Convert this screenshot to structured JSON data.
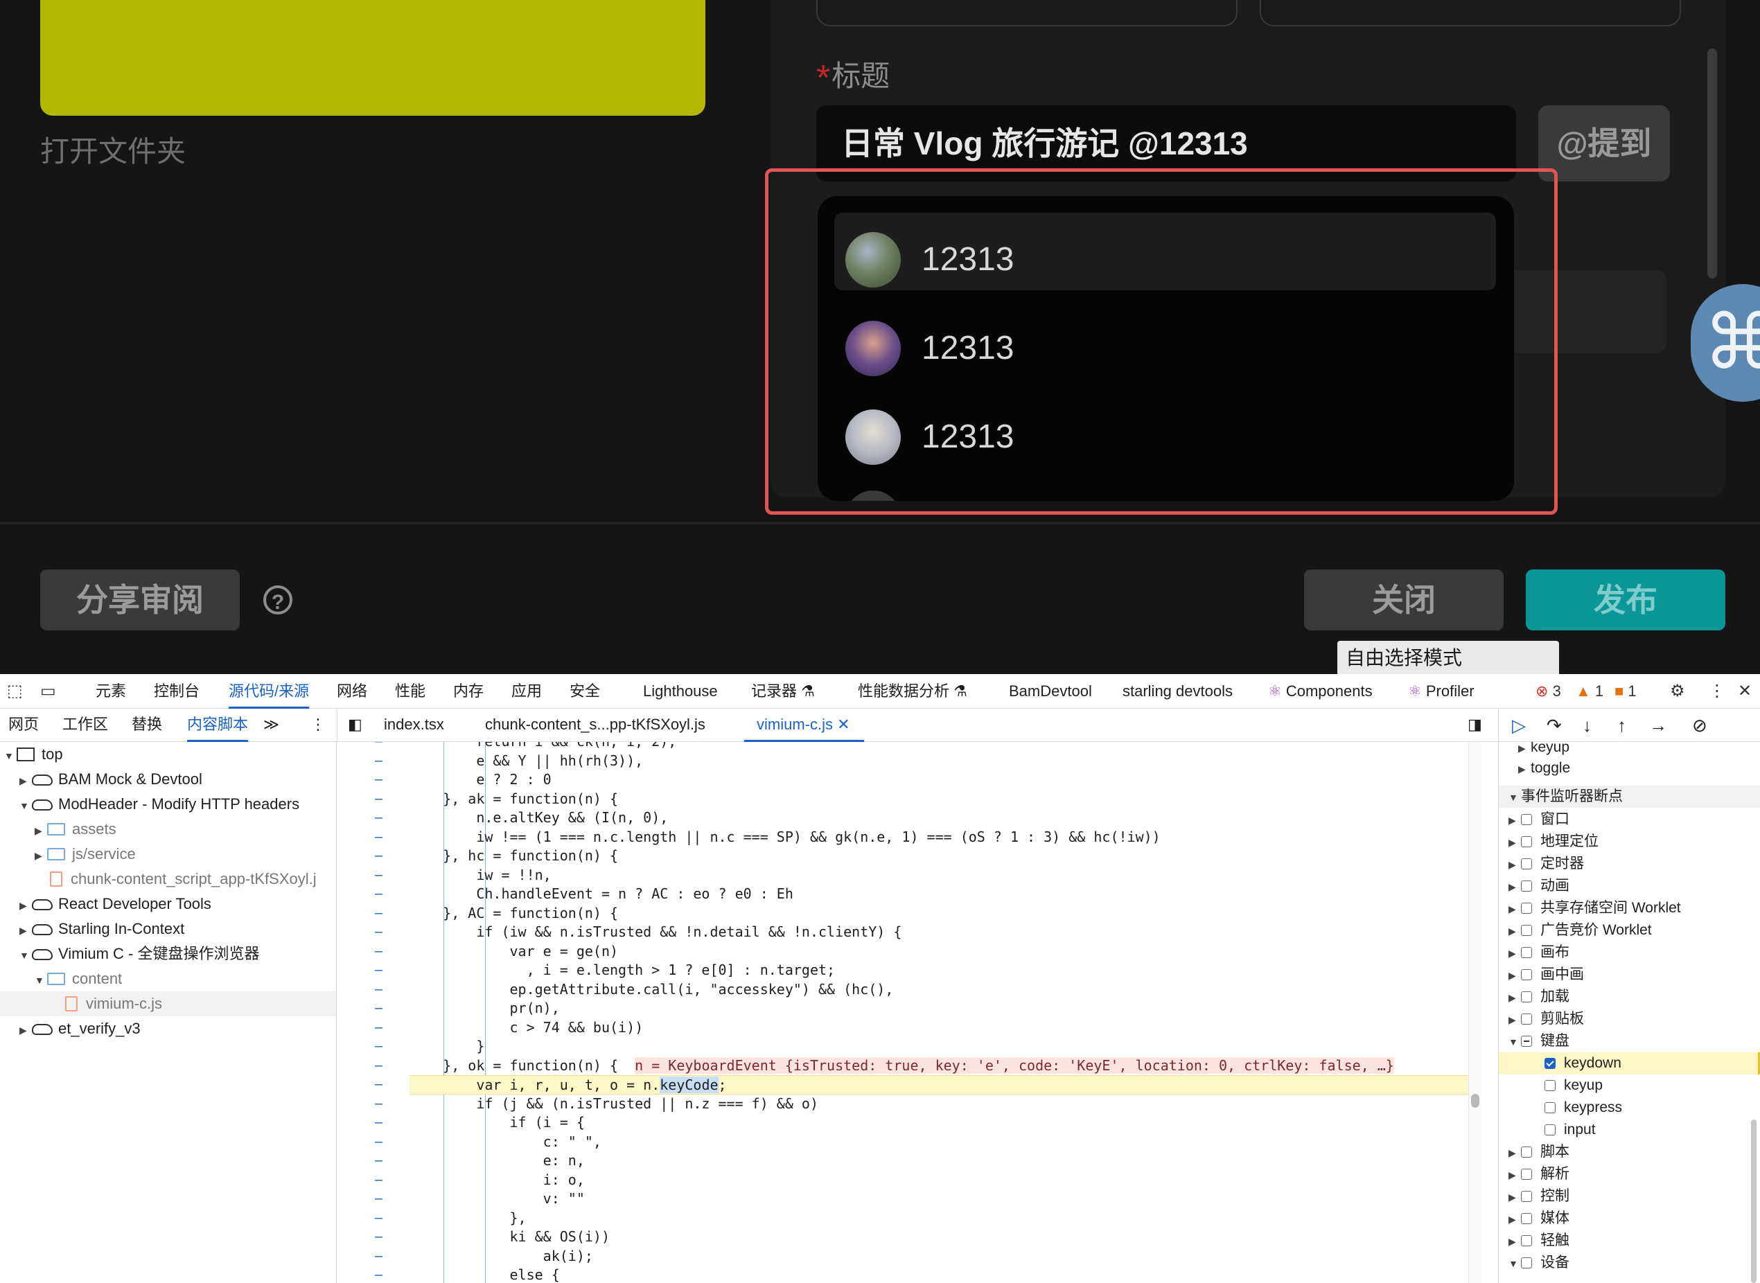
{
  "app": {
    "open_folder": "打开文件夹",
    "title_label": "标题",
    "required_mark": "*",
    "title_value": "日常 Vlog 旅行游记 @12313",
    "mention_button": "@提到",
    "mention_list": [
      {
        "name": "12313",
        "avatar_color": "#7a8a6f"
      },
      {
        "name": "12313",
        "avatar_color": "#5a4a80"
      },
      {
        "name": "12313",
        "avatar_color": "#b9bcc4"
      }
    ],
    "share_review_button": "分享审阅",
    "help_icon": "?",
    "close_button": "关闭",
    "publish_button": "发布",
    "tooltip": "自由选择模式",
    "float_icon": "⌘",
    "colors": {
      "accent": "#0b9698",
      "highlight": "#e35454",
      "yellow_block": "#b5b800"
    }
  },
  "devtools": {
    "main_tabs": [
      "元素",
      "控制台",
      "源代码/来源",
      "网络",
      "性能",
      "内存",
      "应用",
      "安全",
      "Lighthouse",
      "记录器 ⚗",
      "性能数据分析 ⚗",
      "BamDevtool",
      "starling devtools",
      "Components",
      "Profiler"
    ],
    "active_main_tab": "源代码/来源",
    "status": {
      "errors": "3",
      "warnings": "1",
      "issues": "1"
    },
    "sub_tabs": [
      "网页",
      "工作区",
      "替换",
      "内容脚本"
    ],
    "active_sub_tab": "内容脚本",
    "file_tabs": [
      "index.tsx",
      "chunk-content_s...pp-tKfSXoyl.js",
      "vimium-c.js"
    ],
    "active_file_tab": "vimium-c.js",
    "tree": [
      {
        "label": "top",
        "level": 0,
        "icon": "frame",
        "open": true
      },
      {
        "label": "BAM Mock & Devtool",
        "level": 1,
        "icon": "cloud",
        "open": false
      },
      {
        "label": "ModHeader - Modify HTTP headers",
        "level": 1,
        "icon": "cloud",
        "open": true
      },
      {
        "label": "assets",
        "level": 2,
        "icon": "folder",
        "open": false
      },
      {
        "label": "js/service",
        "level": 2,
        "icon": "folder",
        "open": false
      },
      {
        "label": "chunk-content_script_app-tKfSXoyl.j",
        "level": 3,
        "icon": "file"
      },
      {
        "label": "React Developer Tools",
        "level": 1,
        "icon": "cloud",
        "open": false
      },
      {
        "label": "Starling In-Context",
        "level": 1,
        "icon": "cloud",
        "open": false
      },
      {
        "label": "Vimium C - 全键盘操作浏览器",
        "level": 1,
        "icon": "cloud",
        "open": true
      },
      {
        "label": "content",
        "level": 2,
        "icon": "folder",
        "open": true
      },
      {
        "label": "vimium-c.js",
        "level": 3,
        "icon": "file",
        "selected": true
      },
      {
        "label": "et_verify_v3",
        "level": 1,
        "icon": "cloud",
        "open": false
      }
    ],
    "code": {
      "line_01": "        return i && ck(n, i, 2),",
      "line_02": "        e && Y || hh(rh(3)),",
      "line_03": "        e ? 2 : 0",
      "line_04": "    }, ak = function(n) {",
      "line_05": "        n.e.altKey && (I(n, 0),",
      "line_06": "        iw !== (1 === n.c.length || n.c === SP) && gk(n.e, 1) === (oS ? 1 : 3) && hc(!iw))",
      "line_07": "    }, hc = function(n) {",
      "line_08": "        iw = !!n,",
      "line_09": "        Ch.handleEvent = n ? AC : eo ? e0 : Eh",
      "line_10": "    }, AC = function(n) {",
      "line_11": "        if (iw && n.isTrusted && !n.detail && !n.clientY) {",
      "line_12": "            var e = ge(n)",
      "line_13": "              , i = e.length > 1 ? e[0] : n.target;",
      "line_14": "            ep.getAttribute.call(i, \"accesskey\") && (hc(),",
      "line_15": "            pr(n),",
      "line_16": "            c > 74 && bu(i))",
      "line_17": "        }",
      "line_18a": "    }, ok = function(n) {  ",
      "line_18b": "n = KeyboardEvent {isTrusted: true, key: 'e', code: 'KeyE', location: 0, ctrlKey: false, …}",
      "line_19a": "        var i, r, u, t, o = n.",
      "line_19b": "keyCode",
      "line_19c": ";",
      "line_20": "        if (j && (n.isTrusted || n.z === f) && o)",
      "line_21": "            if (i = {",
      "line_22": "                c: \" \",",
      "line_23": "                e: n,",
      "line_24": "                i: o,",
      "line_25": "                v: \"\"",
      "line_26": "            },",
      "line_27": "            ki && OS(i))",
      "line_28": "                ak(i);",
      "line_29": "            else {"
    },
    "breakpoints": {
      "top_items": [
        "keyup",
        "toggle"
      ],
      "section_title": "事件监听器断点",
      "items": [
        {
          "label": "窗口",
          "type": "group"
        },
        {
          "label": "地理定位",
          "type": "group"
        },
        {
          "label": "定时器",
          "type": "group"
        },
        {
          "label": "动画",
          "type": "group"
        },
        {
          "label": "共享存储空间 Worklet",
          "type": "group"
        },
        {
          "label": "广告竞价 Worklet",
          "type": "group"
        },
        {
          "label": "画布",
          "type": "group"
        },
        {
          "label": "画中画",
          "type": "group"
        },
        {
          "label": "加载",
          "type": "group"
        },
        {
          "label": "剪贴板",
          "type": "group"
        },
        {
          "label": "键盘",
          "type": "group-open"
        },
        {
          "label": "keydown",
          "type": "child-checked"
        },
        {
          "label": "keyup",
          "type": "child"
        },
        {
          "label": "keypress",
          "type": "child"
        },
        {
          "label": "input",
          "type": "child"
        },
        {
          "label": "脚本",
          "type": "group"
        },
        {
          "label": "解析",
          "type": "group"
        },
        {
          "label": "控制",
          "type": "group"
        },
        {
          "label": "媒体",
          "type": "group"
        },
        {
          "label": "轻触",
          "type": "group"
        },
        {
          "label": "设备",
          "type": "group-open"
        }
      ]
    }
  }
}
